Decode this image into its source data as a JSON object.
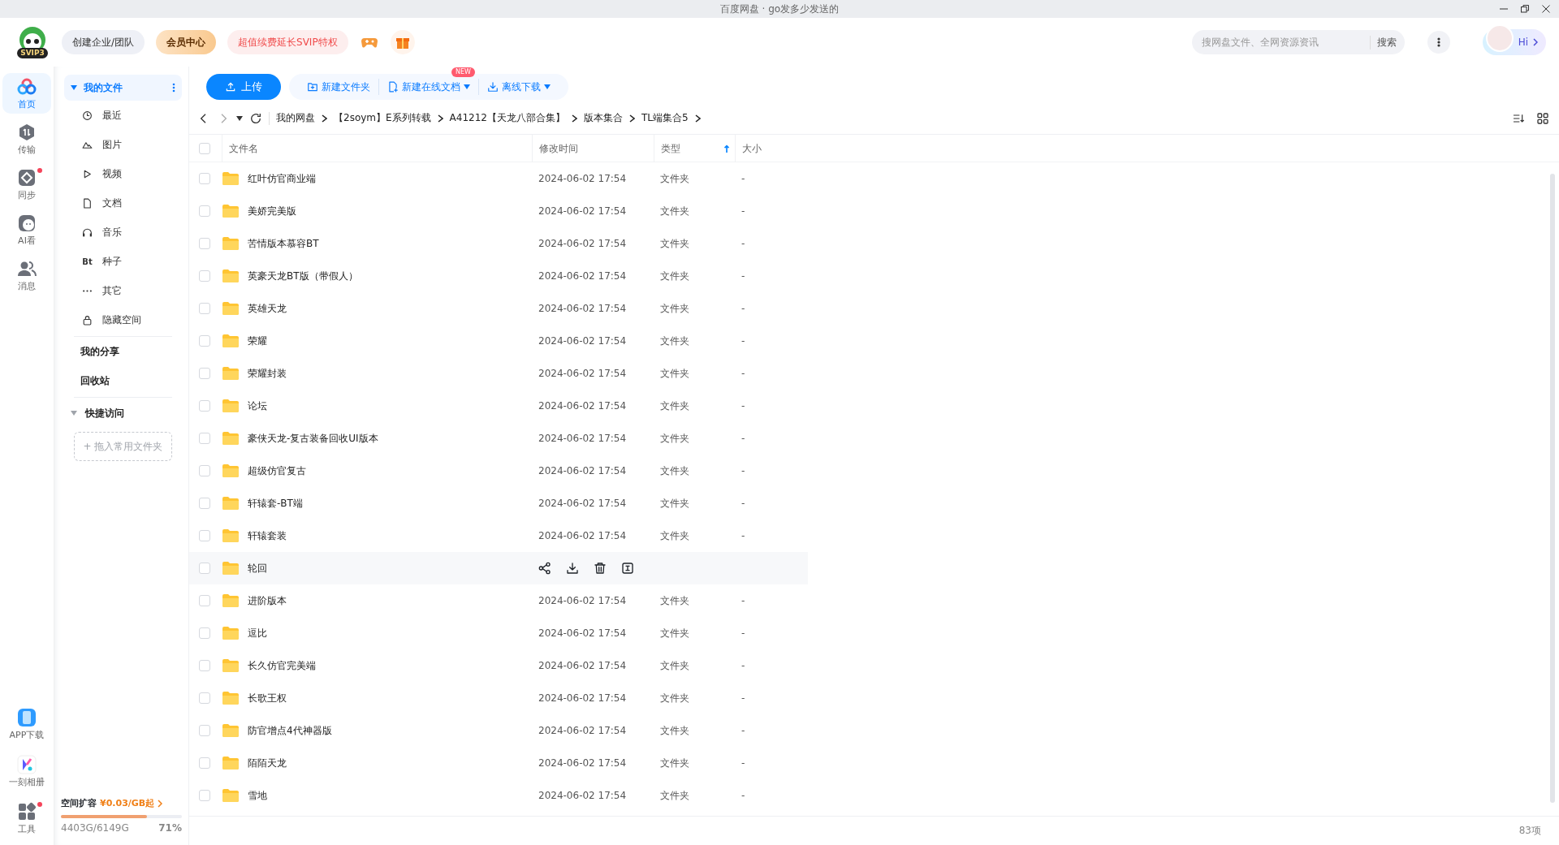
{
  "window": {
    "title": "百度网盘 · go发多少发送的"
  },
  "header": {
    "logo_badge": "SVIP3",
    "buttons": [
      {
        "label": "创建企业/团队",
        "kind": "plain"
      },
      {
        "label": "会员中心",
        "kind": "vip"
      },
      {
        "label": "超值续费延长SVIP特权",
        "kind": "promo"
      }
    ],
    "search": {
      "placeholder": "搜网盘文件、全网资源资讯",
      "button": "搜索"
    },
    "greeting": "Hi"
  },
  "rail": {
    "items": [
      {
        "label": "首页",
        "kind": "cloud",
        "selected": true,
        "badge": false
      },
      {
        "label": "传输",
        "kind": "transfer",
        "selected": false,
        "badge": false
      },
      {
        "label": "同步",
        "kind": "sync",
        "selected": false,
        "badge": true
      },
      {
        "label": "AI看",
        "kind": "ai",
        "selected": false,
        "badge": false
      },
      {
        "label": "消息",
        "kind": "people",
        "selected": false,
        "badge": false
      }
    ],
    "bottom": [
      {
        "label": "APP下载",
        "kind": "phone",
        "badge": false
      },
      {
        "label": "一刻相册",
        "kind": "album",
        "badge": false
      },
      {
        "label": "工具",
        "kind": "tools",
        "badge": true
      }
    ]
  },
  "nav": {
    "root": {
      "label": "我的文件",
      "expanded": true,
      "selected": true
    },
    "items": [
      {
        "label": "最近",
        "kind": "clock"
      },
      {
        "label": "图片",
        "kind": "mountain"
      },
      {
        "label": "视频",
        "kind": "play"
      },
      {
        "label": "文档",
        "kind": "doc"
      },
      {
        "label": "音乐",
        "kind": "headphones"
      },
      {
        "label": "种子",
        "kind": "text",
        "icon_text": "Bt"
      },
      {
        "label": "其它",
        "kind": "dots"
      },
      {
        "label": "隐藏空间",
        "kind": "lock"
      }
    ],
    "links": [
      "我的分享",
      "回收站"
    ],
    "quick": {
      "label": "快捷访问",
      "expanded": true,
      "drop_hint": "+ 拖入常用文件夹"
    },
    "storage": {
      "title": "空间扩容",
      "offer": "¥0.03/GB起",
      "level": 0.71,
      "used": "4403G/6149G",
      "percent": "71%"
    }
  },
  "toolbar": {
    "upload": "上传",
    "actions": [
      {
        "label": "新建文件夹",
        "kind": "folder-plus",
        "dropdown": false
      },
      {
        "label": "新建在线文档",
        "kind": "doc-plus",
        "dropdown": true,
        "badge": "NEW"
      },
      {
        "label": "离线下载",
        "kind": "download",
        "dropdown": true
      }
    ]
  },
  "breadcrumb": [
    "我的网盘",
    "【2soym】E系列转载",
    "A41212【天龙八部合集】",
    "版本集合",
    "TL端集合5"
  ],
  "table": {
    "select_all_checked": false,
    "columns": [
      {
        "label": "文件名",
        "sorted": false
      },
      {
        "label": "修改时间",
        "sorted": false
      },
      {
        "label": "类型",
        "sorted": true
      },
      {
        "label": "大小",
        "sorted": false
      }
    ],
    "rows": [
      {
        "name": "红叶仿官商业端",
        "modified": "2024-06-02 17:54",
        "type": "文件夹",
        "size": "-",
        "checked": false,
        "hovered": false
      },
      {
        "name": "美娇完美版",
        "modified": "2024-06-02 17:54",
        "type": "文件夹",
        "size": "-",
        "checked": false,
        "hovered": false
      },
      {
        "name": "苦情版本慕容BT",
        "modified": "2024-06-02 17:54",
        "type": "文件夹",
        "size": "-",
        "checked": false,
        "hovered": false
      },
      {
        "name": "英豪天龙BT版（带假人）",
        "modified": "2024-06-02 17:54",
        "type": "文件夹",
        "size": "-",
        "checked": false,
        "hovered": false
      },
      {
        "name": "英雄天龙",
        "modified": "2024-06-02 17:54",
        "type": "文件夹",
        "size": "-",
        "checked": false,
        "hovered": false
      },
      {
        "name": "荣耀",
        "modified": "2024-06-02 17:54",
        "type": "文件夹",
        "size": "-",
        "checked": false,
        "hovered": false
      },
      {
        "name": "荣耀封装",
        "modified": "2024-06-02 17:54",
        "type": "文件夹",
        "size": "-",
        "checked": false,
        "hovered": false
      },
      {
        "name": "论坛",
        "modified": "2024-06-02 17:54",
        "type": "文件夹",
        "size": "-",
        "checked": false,
        "hovered": false
      },
      {
        "name": "豪侠天龙-复古装备回收UI版本",
        "modified": "2024-06-02 17:54",
        "type": "文件夹",
        "size": "-",
        "checked": false,
        "hovered": false
      },
      {
        "name": "超级仿官复古",
        "modified": "2024-06-02 17:54",
        "type": "文件夹",
        "size": "-",
        "checked": false,
        "hovered": false
      },
      {
        "name": "轩辕套-BT端",
        "modified": "2024-06-02 17:54",
        "type": "文件夹",
        "size": "-",
        "checked": false,
        "hovered": false
      },
      {
        "name": "轩辕套装",
        "modified": "2024-06-02 17:54",
        "type": "文件夹",
        "size": "-",
        "checked": false,
        "hovered": false
      },
      {
        "name": "轮回",
        "checked": false,
        "hovered": true
      },
      {
        "name": "进阶版本",
        "modified": "2024-06-02 17:54",
        "type": "文件夹",
        "size": "-",
        "checked": false,
        "hovered": false
      },
      {
        "name": "逗比",
        "modified": "2024-06-02 17:54",
        "type": "文件夹",
        "size": "-",
        "checked": false,
        "hovered": false
      },
      {
        "name": "长久仿官完美端",
        "modified": "2024-06-02 17:54",
        "type": "文件夹",
        "size": "-",
        "checked": false,
        "hovered": false
      },
      {
        "name": "长歌王权",
        "modified": "2024-06-02 17:54",
        "type": "文件夹",
        "size": "-",
        "checked": false,
        "hovered": false
      },
      {
        "name": "防官增点4代神器版",
        "modified": "2024-06-02 17:54",
        "type": "文件夹",
        "size": "-",
        "checked": false,
        "hovered": false
      },
      {
        "name": "陌陌天龙",
        "modified": "2024-06-02 17:54",
        "type": "文件夹",
        "size": "-",
        "checked": false,
        "hovered": false
      },
      {
        "name": "雪地",
        "modified": "2024-06-02 17:54",
        "type": "文件夹",
        "size": "-",
        "checked": false,
        "hovered": false
      }
    ]
  },
  "status_bar": {
    "count": "83项"
  }
}
